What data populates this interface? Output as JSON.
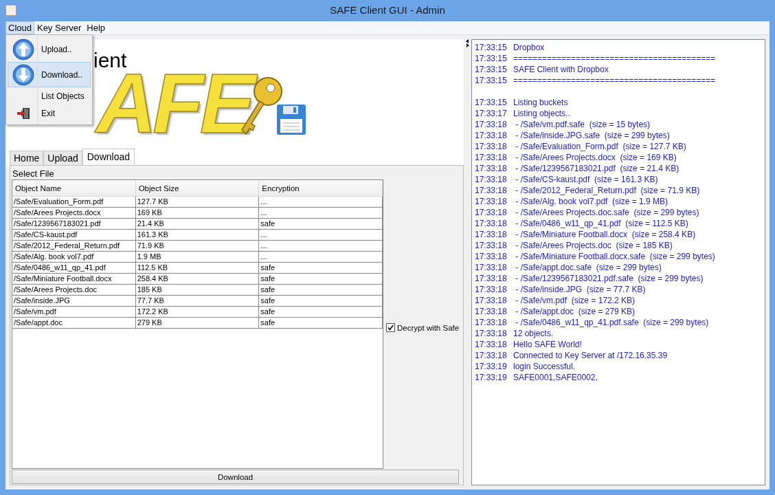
{
  "window": {
    "title": "SAFE Client GUI - Admin"
  },
  "menu_bar": [
    {
      "label": "Cloud",
      "selected": true
    },
    {
      "label": "Key Server",
      "selected": false
    },
    {
      "label": "Help",
      "selected": false
    }
  ],
  "menu": [
    {
      "label": "Upload..",
      "kind": "up",
      "selected": false
    },
    {
      "label": "Download..",
      "kind": "down",
      "selected": true
    },
    {
      "label": "List Objects",
      "kind": "plain",
      "selected": false
    },
    {
      "label": "Exit",
      "kind": "exit",
      "selected": false
    }
  ],
  "logo": {
    "heading": "ient",
    "wordmark": "AFE"
  },
  "tabs": [
    {
      "label": "Home",
      "selected": false
    },
    {
      "label": "Upload",
      "selected": false
    },
    {
      "label": "Download",
      "selected": true
    }
  ],
  "select_label": "Select File",
  "table": {
    "columns": [
      "Object Name",
      "Object Size",
      "Encryption"
    ],
    "rows": [
      [
        "/Safe/Evaluation_Form.pdf",
        "127.7 KB",
        "..."
      ],
      [
        "/Safe/Arees Projects.docx",
        "169 KB",
        "..."
      ],
      [
        "/Safe/1239567183021.pdf",
        "21.4 KB",
        "safe"
      ],
      [
        "/Safe/CS-kaust.pdf",
        "161.3 KB",
        "..."
      ],
      [
        "/Safe/2012_Federal_Return.pdf",
        "71.9 KB",
        "..."
      ],
      [
        "/Safe/Alg. book vol7.pdf",
        "1.9 MB",
        "..."
      ],
      [
        "/Safe/0486_w11_qp_41.pdf",
        "112.5 KB",
        "safe"
      ],
      [
        "/Safe/Miniature Football.docx",
        "258.4 KB",
        "safe"
      ],
      [
        "/Safe/Arees Projects.doc",
        "185 KB",
        "safe"
      ],
      [
        "/Safe/inside.JPG",
        "77.7 KB",
        "safe"
      ],
      [
        "/Safe/vm.pdf",
        "172.2 KB",
        "safe"
      ],
      [
        "/Safe/appt.doc",
        "279 KB",
        "safe"
      ]
    ]
  },
  "decrypt": {
    "label": "Decrypt with Safe",
    "checked": true
  },
  "download_button": "Download",
  "log_blocks": [
    [
      {
        "time": "17:33:15",
        "text": "Dropbox"
      },
      {
        "time": "17:33:15",
        "text": "=========================================="
      },
      {
        "time": "17:33:15",
        "text": "SAFE Client with Dropbox"
      },
      {
        "time": "17:33:15",
        "text": "=========================================="
      }
    ],
    [
      {
        "time": "17:33:15",
        "text": "Listing buckets"
      },
      {
        "time": "17:33:17",
        "text": "Listing objects.."
      },
      {
        "time": "17:33:18",
        "text": " - /Safe/vm.pdf.safe  (size = 15 bytes)"
      },
      {
        "time": "17:33:18",
        "text": " - /Safe/inside.JPG.safe  (size = 299 bytes)"
      },
      {
        "time": "17:33:18",
        "text": " - /Safe/Evaluation_Form.pdf  (size = 127.7 KB)"
      },
      {
        "time": "17:33:18",
        "text": " - /Safe/Arees Projects.docx  (size = 169 KB)"
      },
      {
        "time": "17:33:18",
        "text": " - /Safe/1239567183021.pdf  (size = 21.4 KB)"
      },
      {
        "time": "17:33:18",
        "text": " - /Safe/CS-kaust.pdf  (size = 161.3 KB)"
      },
      {
        "time": "17:33:18",
        "text": " - /Safe/2012_Federal_Return.pdf  (size = 71.9 KB)"
      },
      {
        "time": "17:33:18",
        "text": " - /Safe/Alg. book vol7.pdf  (size = 1.9 MB)"
      },
      {
        "time": "17:33:18",
        "text": " - /Safe/Arees Projects.doc.safe  (size = 299 bytes)"
      },
      {
        "time": "17:33:18",
        "text": " - /Safe/0486_w11_qp_41.pdf  (size = 112.5 KB)"
      },
      {
        "time": "17:33:18",
        "text": " - /Safe/Miniature Football.docx  (size = 258.4 KB)"
      },
      {
        "time": "17:33:18",
        "text": " - /Safe/Arees Projects.doc  (size = 185 KB)"
      },
      {
        "time": "17:33:18",
        "text": " - /Safe/Miniature Football.docx.safe  (size = 299 bytes)"
      },
      {
        "time": "17:33:18",
        "text": " - /Safe/appt.doc.safe  (size = 299 bytes)"
      },
      {
        "time": "17:33:18",
        "text": " - /Safe/1239567183021.pdf.safe  (size = 299 bytes)"
      },
      {
        "time": "17:33:18",
        "text": " - /Safe/inside.JPG  (size = 77.7 KB)"
      },
      {
        "time": "17:33:18",
        "text": " - /Safe/vm.pdf  (size = 172.2 KB)"
      },
      {
        "time": "17:33:18",
        "text": " - /Safe/appt.doc  (size = 279 KB)"
      },
      {
        "time": "17:33:18",
        "text": " - /Safe/0486_w11_qp_41.pdf.safe  (size = 299 bytes)"
      },
      {
        "time": "17:33:18",
        "text": "12 objects."
      },
      {
        "time": "17:33:18",
        "text": "Hello SAFE World!"
      },
      {
        "time": "17:33:18",
        "text": "Connected to Key Server at /172.16.35.39"
      },
      {
        "time": "17:33:19",
        "text": "login Successful."
      },
      {
        "time": "17:33:19",
        "text": "SAFE0001,SAFE0002,"
      }
    ]
  ]
}
